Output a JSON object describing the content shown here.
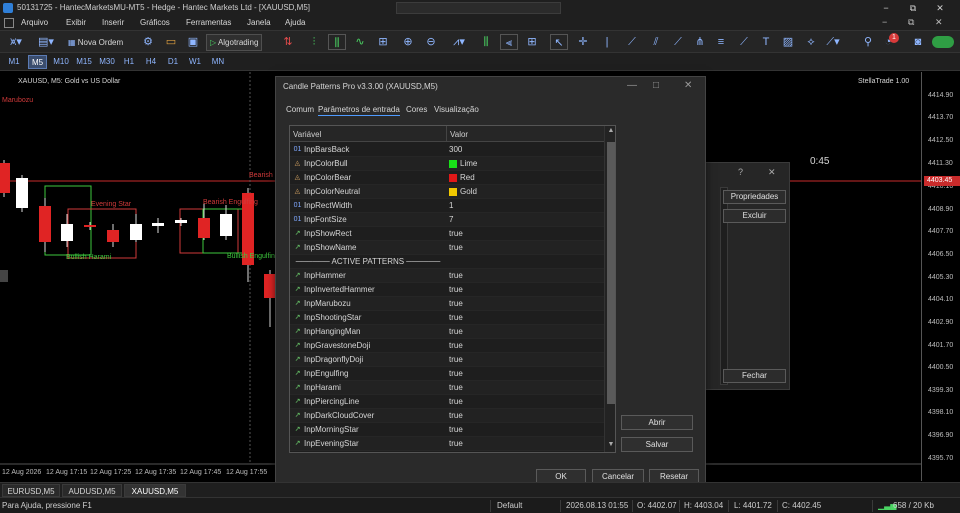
{
  "window": {
    "title": "50131725 - HantecMarketsMU-MT5 - Hedge - Hantec Markets Ltd - [XAUUSD,M5]",
    "controls": [
      "−",
      "⧉",
      "✕"
    ]
  },
  "menu": {
    "items": [
      "Arquivo",
      "Exibir",
      "Inserir",
      "Gráficos",
      "Ferramentas",
      "Janela",
      "Ajuda"
    ]
  },
  "toolbar": {
    "new_order": "Nova Ordem",
    "algotrading": "Algotrading",
    "notification_count": "1"
  },
  "timeframes": {
    "items": [
      "M1",
      "M5",
      "M10",
      "M15",
      "M30",
      "H1",
      "H4",
      "D1",
      "W1",
      "MN"
    ],
    "active": "M5"
  },
  "chart": {
    "symbol_label": "XAUUSD, M5:  Gold vs US Dollar",
    "indicator_label": "Marubozu",
    "brand": "StellaTrade 1.00",
    "timer": "0:45",
    "current_price": "4403.45",
    "price_labels": [
      "4414.90",
      "4413.70",
      "4412.50",
      "4411.30",
      "4410.10",
      "4408.90",
      "4407.70",
      "4406.50",
      "4405.30",
      "4404.10",
      "4402.90",
      "4401.70",
      "4400.50",
      "4399.30",
      "4398.10",
      "4396.90",
      "4395.70"
    ],
    "time_labels": [
      "12 Aug 2026",
      "12 Aug 17:15",
      "12 Aug 17:25",
      "12 Aug 17:35",
      "12 Aug 17:45",
      "12 Aug 17:55"
    ],
    "patterns": [
      {
        "text": "Evening Star",
        "color": "#d03a3a"
      },
      {
        "text": "Bullish Harami",
        "color": "#3ec93e"
      },
      {
        "text": "Bearish Engulfing",
        "color": "#d03a3a"
      },
      {
        "text": "Bullish Engulfing",
        "color": "#3ec93e"
      },
      {
        "text": "Bearish M",
        "color": "#d03a3a"
      }
    ],
    "colors": {
      "bull": "#ffffff",
      "bear": "#e02424",
      "line": "#c92b2b"
    }
  },
  "props_dialog": {
    "properties": "Propriedades",
    "delete": "Excluir",
    "close": "Fechar",
    "controls": [
      "?",
      "✕"
    ]
  },
  "dialog": {
    "title": "Candle Patterns Pro v3.3.00 (XAUUSD,M5)",
    "controls": [
      "—",
      "□",
      "✕"
    ],
    "tabs": [
      "Comum",
      "Parâmetros de entrada",
      "Cores",
      "Visualização"
    ],
    "active_tab": "Parâmetros de entrada",
    "columns": {
      "variable": "Variável",
      "value": "Valor"
    },
    "rows": [
      {
        "icon": "01",
        "type": "int",
        "name": "InpBarsBack",
        "value": "300"
      },
      {
        "icon": "◬",
        "type": "color",
        "name": "InpColorBull",
        "value": "Lime",
        "swatch": "#18e018"
      },
      {
        "icon": "◬",
        "type": "color",
        "name": "InpColorBear",
        "value": "Red",
        "swatch": "#e01818"
      },
      {
        "icon": "◬",
        "type": "color",
        "name": "InpColorNeutral",
        "value": "Gold",
        "swatch": "#f0c800"
      },
      {
        "icon": "01",
        "type": "int",
        "name": "InpRectWidth",
        "value": "1"
      },
      {
        "icon": "01",
        "type": "int",
        "name": "InpFontSize",
        "value": "7"
      },
      {
        "icon": "↗",
        "type": "bool",
        "name": "InpShowRect",
        "value": "true"
      },
      {
        "icon": "↗",
        "type": "bool",
        "name": "InpShowName",
        "value": "true"
      },
      {
        "icon": "",
        "type": "separator",
        "name": "────── ACTIVE PATTERNS ──────",
        "value": ""
      },
      {
        "icon": "↗",
        "type": "bool",
        "name": "InpHammer",
        "value": "true"
      },
      {
        "icon": "↗",
        "type": "bool",
        "name": "InpInvertedHammer",
        "value": "true"
      },
      {
        "icon": "↗",
        "type": "bool",
        "name": "InpMarubozu",
        "value": "true"
      },
      {
        "icon": "↗",
        "type": "bool",
        "name": "InpShootingStar",
        "value": "true"
      },
      {
        "icon": "↗",
        "type": "bool",
        "name": "InpHangingMan",
        "value": "true"
      },
      {
        "icon": "↗",
        "type": "bool",
        "name": "InpGravestoneDoji",
        "value": "true"
      },
      {
        "icon": "↗",
        "type": "bool",
        "name": "InpDragonflyDoji",
        "value": "true"
      },
      {
        "icon": "↗",
        "type": "bool",
        "name": "InpEngulfing",
        "value": "true"
      },
      {
        "icon": "↗",
        "type": "bool",
        "name": "InpHarami",
        "value": "true"
      },
      {
        "icon": "↗",
        "type": "bool",
        "name": "InpPiercingLine",
        "value": "true"
      },
      {
        "icon": "↗",
        "type": "bool",
        "name": "InpDarkCloudCover",
        "value": "true"
      },
      {
        "icon": "↗",
        "type": "bool",
        "name": "InpMorningStar",
        "value": "true"
      },
      {
        "icon": "↗",
        "type": "bool",
        "name": "InpEveningStar",
        "value": "true"
      }
    ],
    "buttons": {
      "open": "Abrir",
      "save": "Salvar",
      "ok": "OK",
      "cancel": "Cancelar",
      "reset": "Resetar"
    }
  },
  "bottom_tabs": {
    "items": [
      "EURUSD,M5",
      "AUDUSD,M5",
      "XAUUSD,M5"
    ],
    "active": "XAUUSD,M5"
  },
  "status": {
    "help": "Para Ajuda, pressione F1",
    "profile": "Default",
    "datetime": "2026.08.13 01:55",
    "open": "O: 4402.07",
    "high": "H: 4403.04",
    "low": "L: 4401.72",
    "close": "C: 4402.45",
    "traffic": "658 / 20 Kb"
  }
}
